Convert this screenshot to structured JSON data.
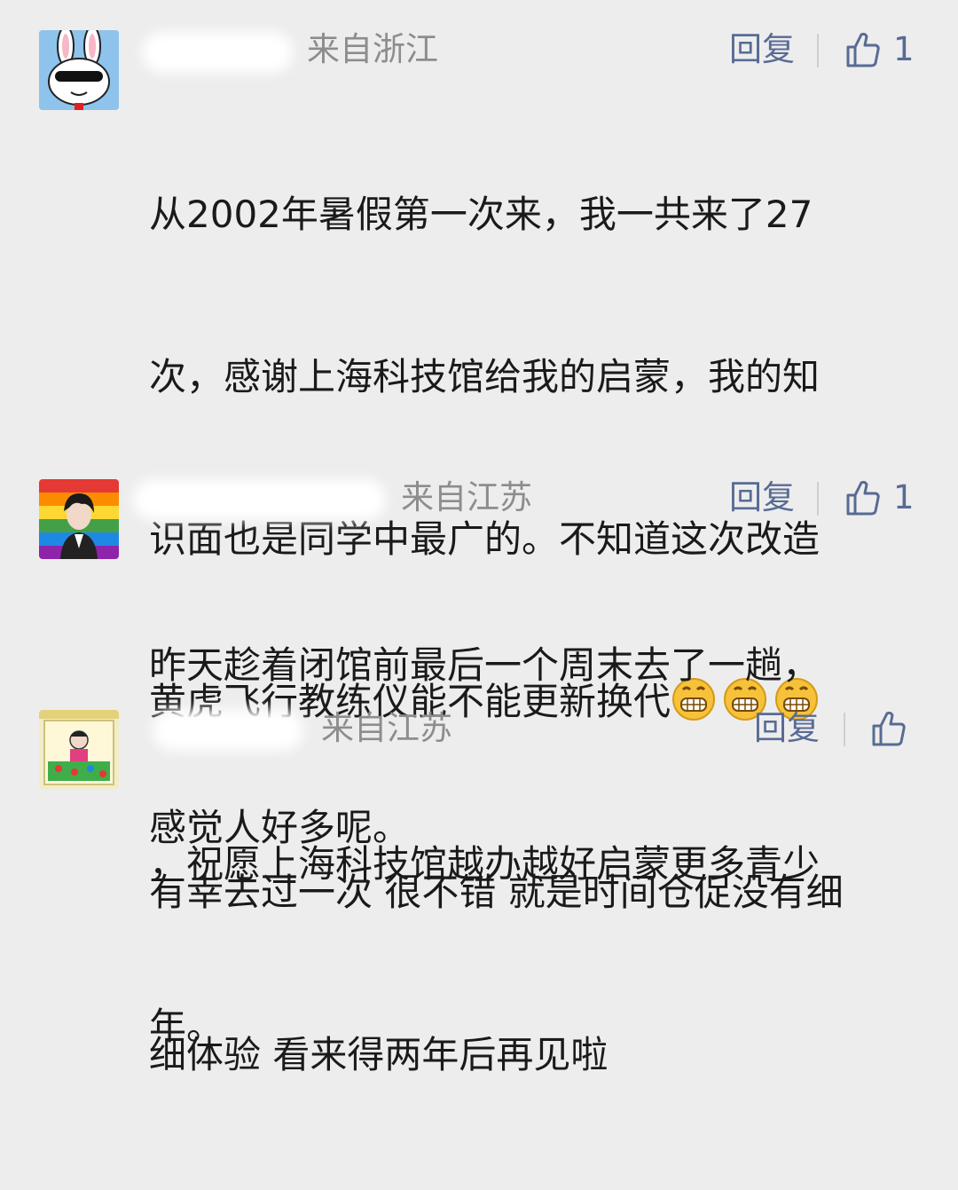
{
  "comments": [
    {
      "location": "来自浙江",
      "reply_label": "回复",
      "like_count": "1",
      "text_lines": [
        "从2002年暑假第一次来，我一共来了27",
        "次，感谢上海科技馆给我的启蒙，我的知",
        "识面也是同学中最广的。不知道这次改造",
        "黄虎飞行教练仪能不能更新换代",
        "，祝愿上海科技馆越办越好启蒙更多青少",
        "年。"
      ],
      "emoji": [
        "grin-emoji",
        "grin-emoji",
        "grin-emoji"
      ]
    },
    {
      "location": "来自江苏",
      "reply_label": "回复",
      "like_count": "1",
      "text_lines": [
        "昨天趁着闭馆前最后一个周末去了一趟，",
        "感觉人好多呢。"
      ]
    },
    {
      "location": "来自江苏",
      "reply_label": "回复",
      "like_count": "",
      "text_lines": [
        "有幸去过一次 很不错 就是时间仓促没有细",
        "细体验 看来得两年后再见啦"
      ]
    }
  ],
  "colors": {
    "background": "#ededed",
    "link": "#586b94",
    "meta": "#8d8d8d",
    "text": "#1a1a1a"
  },
  "icons": [
    "thumbs-up-icon",
    "grin-emoji"
  ]
}
